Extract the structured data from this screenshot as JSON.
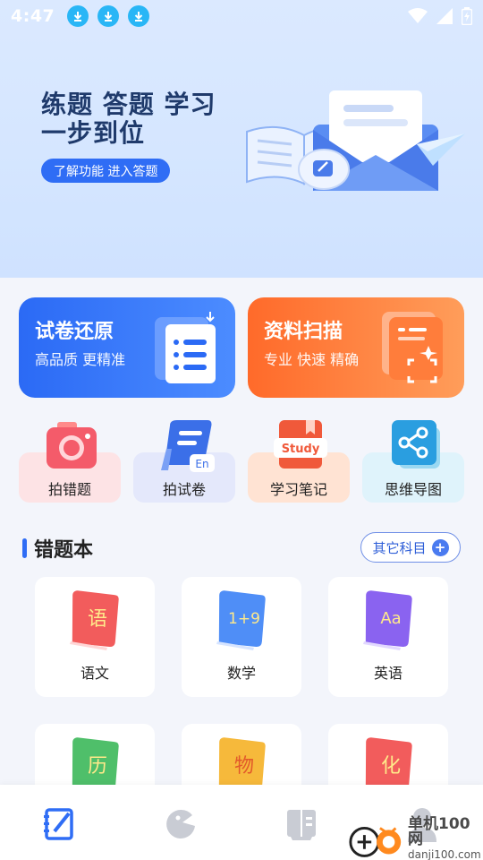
{
  "status_bar": {
    "time": "4:47"
  },
  "hero": {
    "title_line1": "练题 答题 学习",
    "title_line2": "一步到位",
    "cta": "了解功能 进入答题"
  },
  "features": [
    {
      "title": "试卷还原",
      "subtitle": "高品质 更精准",
      "color": "#2b6af5"
    },
    {
      "title": "资料扫描",
      "subtitle": "专业 快速 精确",
      "color": "#ff6a2a"
    }
  ],
  "tools": [
    {
      "label": "拍错题",
      "bg": "#fde3e5",
      "icon": "camera-icon"
    },
    {
      "label": "拍试卷",
      "bg": "#e4e8fb",
      "icon": "paper-scroll-icon",
      "badge": "En"
    },
    {
      "label": "学习笔记",
      "bg": "#ffe3d3",
      "icon": "study-notebook-icon",
      "badge": "Study"
    },
    {
      "label": "思维导图",
      "bg": "#dff3fb",
      "icon": "mind-map-icon"
    }
  ],
  "wrong_book": {
    "title": "错题本",
    "other_button": "其它科目"
  },
  "subjects": [
    {
      "label": "语文",
      "glyph": "语",
      "color": "#f25c5c"
    },
    {
      "label": "数学",
      "glyph": "1+9",
      "color": "#4f8ef7"
    },
    {
      "label": "英语",
      "glyph": "Aa",
      "color": "#8a63f0"
    },
    {
      "glyph": "历",
      "color": "#4fbf6a"
    },
    {
      "glyph": "物",
      "color": "#f6b93b"
    },
    {
      "glyph": "化",
      "color": "#f25c5c"
    }
  ],
  "bottom_nav": [
    "notebook-icon",
    "game-icon",
    "book-icon",
    "profile-icon"
  ],
  "watermark": {
    "name": "单机100网",
    "url": "danji100.com"
  }
}
